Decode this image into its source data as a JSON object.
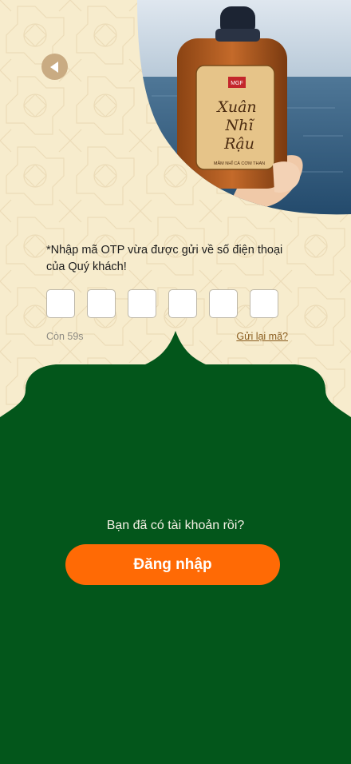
{
  "colors": {
    "background": "#f7eccd",
    "pattern": "#ecdcb8",
    "green": "#03561b",
    "orange": "#ff6a05",
    "accent_brown": "#8a5d1f",
    "back_button": "#c9ab82"
  },
  "header": {
    "back_icon": "back-arrow-icon",
    "product_image": {
      "brand_logo": "MGF",
      "label_text": "Xuân Nhĩ Rậu",
      "label_subtext": "MẮM NHĨ CÁ CƠM THAN"
    }
  },
  "otp": {
    "instruction": "*Nhập mã OTP vừa được gửi về số điện thoại của Quý khách!",
    "digits": [
      "",
      "",
      "",
      "",
      "",
      ""
    ],
    "countdown": "Còn 59s",
    "resend_label": "Gửi lại mã?"
  },
  "login": {
    "question": "Bạn đã có tài khoản rồi?",
    "button_label": "Đăng nhập"
  }
}
